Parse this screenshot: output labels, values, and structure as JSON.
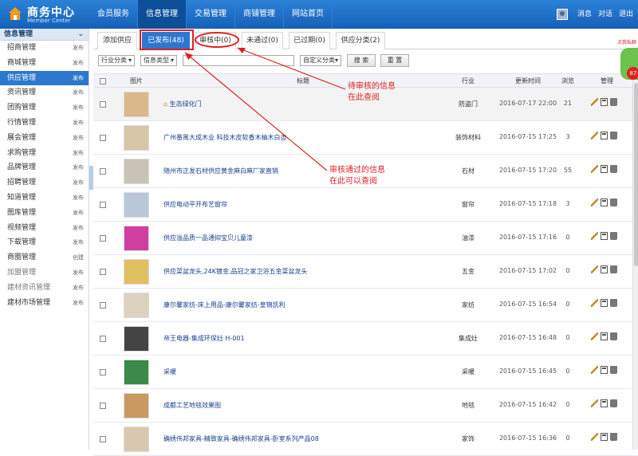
{
  "header": {
    "brand_title": "商务中心",
    "brand_sub": "Member Center",
    "nav": [
      "会员服务",
      "信息管理",
      "交易管理",
      "商铺管理",
      "网站首页"
    ],
    "nav_active": 1,
    "user_links": [
      "消息",
      "对话",
      "退出"
    ]
  },
  "sidebar": {
    "title": "信息管理",
    "items": [
      {
        "label": "招商管理",
        "tag": "发布"
      },
      {
        "label": "商城管理",
        "tag": "发布"
      },
      {
        "label": "供应管理",
        "tag": "发布",
        "active": true
      },
      {
        "label": "资讯管理",
        "tag": "发布"
      },
      {
        "label": "团购管理",
        "tag": "发布"
      },
      {
        "label": "行情管理",
        "tag": "发布"
      },
      {
        "label": "展会管理",
        "tag": "发布"
      },
      {
        "label": "求购管理",
        "tag": "发布"
      },
      {
        "label": "品牌管理",
        "tag": "发布"
      },
      {
        "label": "招聘管理",
        "tag": "发布"
      },
      {
        "label": "知道管理",
        "tag": "发布"
      },
      {
        "label": "图库管理",
        "tag": "发布"
      },
      {
        "label": "视频管理",
        "tag": "发布"
      },
      {
        "label": "下载管理",
        "tag": "发布"
      },
      {
        "label": "商圈管理",
        "tag": "创建"
      },
      {
        "label": "加盟管理",
        "tag": "发布",
        "dim": true
      },
      {
        "label": "建材资讯管理",
        "tag": "发布",
        "dim": true
      },
      {
        "label": "建材市场管理",
        "tag": "发布"
      }
    ]
  },
  "tabs": [
    "添加供应",
    "已发布(48)",
    "审核中(0)",
    "未通过(0)",
    "已过期(0)",
    "供应分类(2)"
  ],
  "filters": {
    "industry": "行业分类",
    "info_type": "信息类型",
    "search_value": "",
    "custom": "自定义分类",
    "search_btn": "搜 索",
    "reset_btn": "重 置"
  },
  "table": {
    "headers": [
      "图片",
      "标题",
      "行业",
      "更新时间",
      "浏览",
      "管理"
    ],
    "rows": [
      {
        "title": "生态绿化门",
        "industry": "防盗门",
        "time": "2016-07-17 22:00",
        "views": "21",
        "home": true
      },
      {
        "title": "广州番禺大成木业 科技木皮软香木柚木白杏",
        "industry": "装饰材料",
        "time": "2016-07-15 17:25",
        "views": "3"
      },
      {
        "title": "随州市正发石材供应黄金麻白麻厂家直销",
        "industry": "石材",
        "time": "2016-07-15 17:20",
        "views": "55"
      },
      {
        "title": "供应电动平开布艺窗帘",
        "industry": "窗帘",
        "time": "2016-07-15 17:18",
        "views": "3"
      },
      {
        "title": "供应溢品质一品通抑宝贝儿童漆",
        "industry": "油漆",
        "time": "2016-07-15 17:16",
        "views": "0"
      },
      {
        "title": "供应菜盆龙头,24K镀金,品冠之家卫浴五金菜盆龙头",
        "industry": "五金",
        "time": "2016-07-15 17:02",
        "views": "0"
      },
      {
        "title": "康尔馨家纺-床上用品-康尔馨家纺-皇锦凯利",
        "industry": "家纺",
        "time": "2016-07-15 16:54",
        "views": "0"
      },
      {
        "title": "帝王电器-集成环保灶 H-001",
        "industry": "集成灶",
        "time": "2016-07-15 16:48",
        "views": "0"
      },
      {
        "title": "采暖",
        "industry": "采暖",
        "time": "2016-07-15 16:45",
        "views": "0"
      },
      {
        "title": "成都工艺地毯效果图",
        "industry": "地毯",
        "time": "2016-07-15 16:42",
        "views": "0"
      },
      {
        "title": "确绣伟邦家具-精致家具-确绣伟邦家具-卧室系列产品08",
        "industry": "家饰",
        "time": "2016-07-15 16:36",
        "views": "0"
      }
    ]
  },
  "annotations": {
    "pending": [
      "待审核的信息",
      "在此查阅"
    ],
    "approved": [
      "审核通过的信息",
      "在此可以查阅"
    ]
  },
  "float": {
    "label": "点我私聊",
    "badge": "87"
  },
  "colors": {
    "nav": "#1b6dc4",
    "active": "#2c77cf",
    "annotation": "#e02020"
  }
}
